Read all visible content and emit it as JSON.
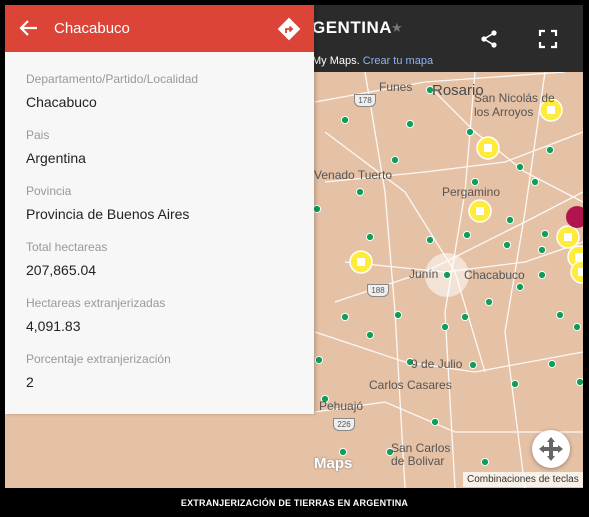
{
  "panel": {
    "title": "Chacabuco",
    "fields": [
      {
        "label": "Departamento/Partido/Localidad",
        "value": "Chacabuco"
      },
      {
        "label": "Pais",
        "value": "Argentina"
      },
      {
        "label": "Povincia",
        "value": "Provincia de Buenos Aires"
      },
      {
        "label": "Total hectareas",
        "value": "207,865.04"
      },
      {
        "label": "Hectareas extranjerizadas",
        "value": "4,091.83"
      },
      {
        "label": "Porcentaje extranjerización",
        "value": "2"
      }
    ]
  },
  "header": {
    "map_title": "GENTINA",
    "mymaps_prefix": "My Maps.",
    "mymaps_link": "Crear tu mapa"
  },
  "map": {
    "places": [
      "Funes",
      "Rosario",
      "San Nicolás de",
      "los Arroyos",
      "Venado Tuerto",
      "Pergamino",
      "Junín",
      "Chacabuco",
      "9 de Julio",
      "Carlos Casares",
      "Pehuajó",
      "San Carlos",
      "de Bolivar"
    ],
    "routes": [
      "178",
      "188",
      "226"
    ],
    "watermark": "Maps",
    "shortcuts": "Combinaciones de teclas"
  },
  "caption": "EXTRANJERIZACIÓN DE TIERRAS EN ARGENTINA",
  "colors": {
    "panel_header": "#db4437",
    "marker_green": "#0f9d58",
    "marker_yellow": "#ffeb3b"
  },
  "icons": [
    "back-arrow-icon",
    "directions-icon",
    "star-icon",
    "share-icon",
    "fullscreen-icon",
    "nav-control-icon"
  ]
}
